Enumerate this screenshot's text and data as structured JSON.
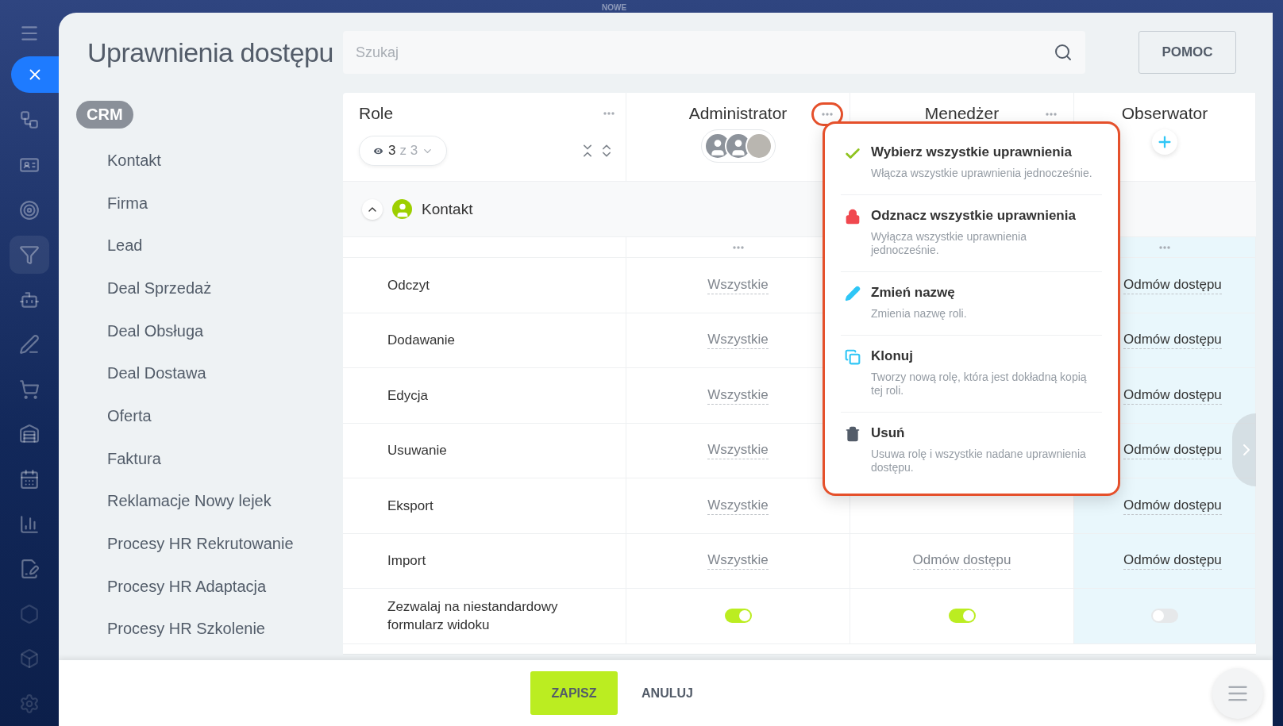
{
  "backdrop": {
    "label": "NOWE"
  },
  "page": {
    "title": "Uprawnienia dostępu",
    "search": {
      "placeholder": "Szukaj"
    },
    "help_button": "POMOC"
  },
  "sidebar": {
    "section": "CRM",
    "items": [
      {
        "label": "Kontakt"
      },
      {
        "label": "Firma"
      },
      {
        "label": "Lead"
      },
      {
        "label": "Deal Sprzedaż"
      },
      {
        "label": "Deal Obsługa"
      },
      {
        "label": "Deal Dostawa"
      },
      {
        "label": "Oferta"
      },
      {
        "label": "Faktura"
      },
      {
        "label": "Reklamacje Nowy lejek"
      },
      {
        "label": "Procesy HR Rekrutowanie"
      },
      {
        "label": "Procesy HR Adaptacja"
      },
      {
        "label": "Procesy HR Szkolenie"
      }
    ]
  },
  "table": {
    "role_header": {
      "title": "Role",
      "visible_count": "3",
      "total": "z 3"
    },
    "roles": [
      {
        "name": "Administrator",
        "kind": "avatars",
        "menu_open": true,
        "highlighted": false
      },
      {
        "name": "Menedżer",
        "kind": "menu",
        "menu_open": false,
        "highlighted": false
      },
      {
        "name": "Obserwator",
        "kind": "add",
        "highlighted": true
      }
    ],
    "group": {
      "label": "Kontakt",
      "expanded": true
    },
    "rows": [
      {
        "label": "Odczyt",
        "kind": "select",
        "cells": [
          "Wszystkie",
          null,
          "Odmów dostępu"
        ]
      },
      {
        "label": "Dodawanie",
        "kind": "select",
        "cells": [
          "Wszystkie",
          null,
          "Odmów dostępu"
        ]
      },
      {
        "label": "Edycja",
        "kind": "select",
        "cells": [
          "Wszystkie",
          null,
          "Odmów dostępu"
        ]
      },
      {
        "label": "Usuwanie",
        "kind": "select",
        "cells": [
          "Wszystkie",
          null,
          "Odmów dostępu"
        ]
      },
      {
        "label": "Eksport",
        "kind": "select",
        "cells": [
          "Wszystkie",
          null,
          "Odmów dostępu"
        ]
      },
      {
        "label": "Import",
        "kind": "select",
        "cells": [
          "Wszystkie",
          "Odmów dostępu",
          "Odmów dostępu"
        ]
      },
      {
        "label": "Zezwalaj na niestandardowy formularz widoku",
        "kind": "toggle",
        "cells": [
          {
            "on": true
          },
          {
            "on": true
          },
          {
            "on": false
          }
        ]
      }
    ]
  },
  "menu": {
    "items": [
      {
        "kind": "check",
        "title": "Wybierz wszystkie uprawnienia",
        "description": "Włącza wszystkie uprawnienia jednocześnie."
      },
      {
        "kind": "lock",
        "title": "Odznacz wszystkie uprawnienia",
        "description": "Wyłącza wszystkie uprawnienia jednocześnie."
      },
      {
        "kind": "rename",
        "title": "Zmień nazwę",
        "description": "Zmienia nazwę roli."
      },
      {
        "kind": "clone",
        "title": "Klonuj",
        "description": "Tworzy nową rolę, która jest dokładną kopią tej roli."
      },
      {
        "kind": "delete",
        "title": "Usuń",
        "description": "Usuwa rolę i wszystkie nadane uprawnienia dostępu."
      }
    ]
  },
  "footer": {
    "save": "ZAPISZ",
    "cancel": "ANULUJ"
  }
}
